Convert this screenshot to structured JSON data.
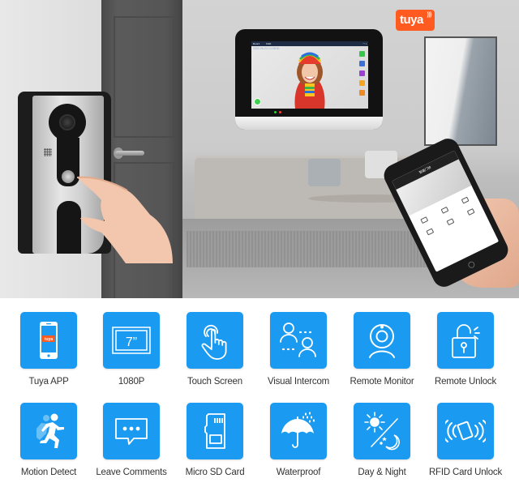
{
  "brand": {
    "logo_text": "tuya",
    "logo_color": "#ff5a1f"
  },
  "hero": {
    "monitor": {
      "status_bar": {
        "channel": "Door1",
        "quality": "FHD"
      },
      "timestamp": "2022-06-24  14:35:00",
      "side_buttons": [
        {
          "icon": "message-icon",
          "color": "#35c74a"
        },
        {
          "icon": "monitor-icon",
          "color": "#3a6fd8"
        },
        {
          "icon": "phone-icon",
          "color": "#9b3fd6"
        },
        {
          "icon": "unlock-icon",
          "color": "#f5a623"
        },
        {
          "icon": "camera-icon",
          "color": "#f08a24"
        }
      ],
      "call_button_color": "#3fcf4f",
      "leds": [
        "#2ecc40",
        "#ff3b30"
      ]
    },
    "phone": {
      "app_title": "智能门铃"
    }
  },
  "accent_color": "#1a9af0",
  "features": [
    {
      "label": "Tuya APP",
      "icon": "tuya-app-phone-icon",
      "tile_text": "tuya"
    },
    {
      "label": "1080P",
      "icon": "screen-size-icon",
      "tile_text": "7”"
    },
    {
      "label": "Touch Screen",
      "icon": "touch-hand-icon"
    },
    {
      "label": "Visual Intercom",
      "icon": "intercom-users-icon"
    },
    {
      "label": "Remote Monitor",
      "icon": "webcam-icon"
    },
    {
      "label": "Remote Unlock",
      "icon": "unlock-padlock-icon"
    },
    {
      "label": "Motion Detect",
      "icon": "running-person-icon"
    },
    {
      "label": "Leave Comments",
      "icon": "chat-bubble-icon"
    },
    {
      "label": "Micro SD Card",
      "icon": "sd-card-icon"
    },
    {
      "label": "Waterproof",
      "icon": "umbrella-rain-icon"
    },
    {
      "label": "Day & Night",
      "icon": "sun-moon-icon"
    },
    {
      "label": "RFID Card Unlock",
      "icon": "rfid-card-icon"
    }
  ]
}
